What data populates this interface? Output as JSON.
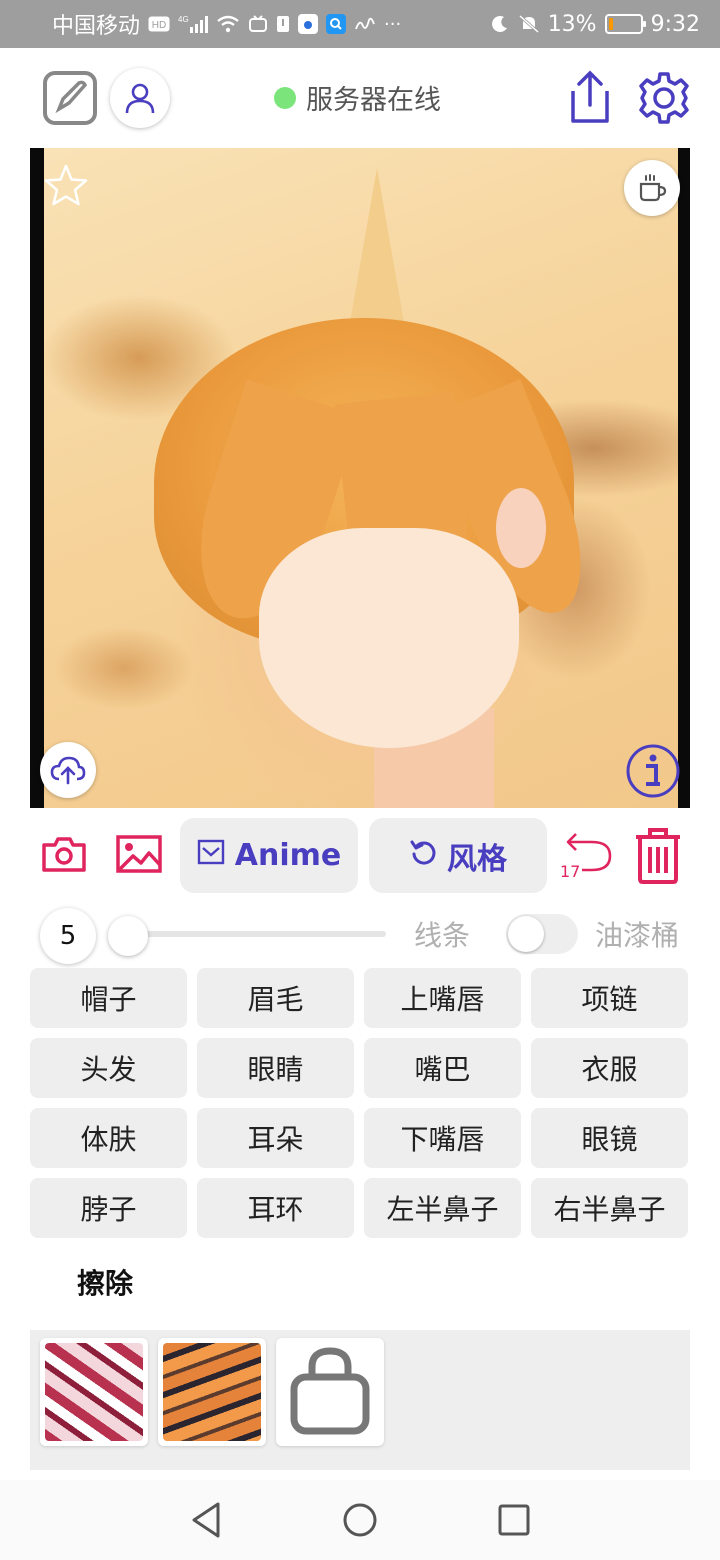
{
  "status_bar": {
    "carrier": "中国移动",
    "network": "4G",
    "battery": "13%",
    "time": "9:32",
    "battery_level": 0.13
  },
  "header": {
    "server_status": "服务器在线",
    "server_status_color": "#7be57b"
  },
  "toolbar": {
    "style_label": "Anime",
    "style_button": "风格",
    "undo_count": "17",
    "accent_color": "#e0245e",
    "primary_color": "#4a3ec0"
  },
  "brush": {
    "size": "5",
    "line_label": "线条",
    "bucket_label": "油漆桶",
    "bucket_enabled": false
  },
  "labels": [
    "帽子",
    "眉毛",
    "上嘴唇",
    "项链",
    "头发",
    "眼睛",
    "嘴巴",
    "衣服",
    "体肤",
    "耳朵",
    "下嘴唇",
    "眼镜",
    "脖子",
    "耳环",
    "左半鼻子",
    "右半鼻子"
  ],
  "erase_label": "擦除",
  "style_thumbs": [
    "style-1",
    "style-2"
  ]
}
